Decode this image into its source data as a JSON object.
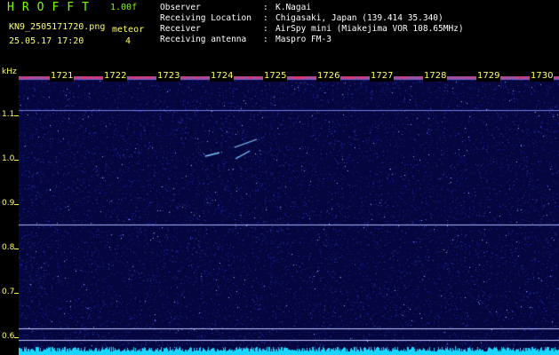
{
  "header": {
    "app_title": "HROFFT",
    "version": "1.00f",
    "filename": "KN9_2505171720.png",
    "mode": "meteor",
    "datetime": "25.05.17 17:20",
    "count": "4"
  },
  "meta": [
    {
      "key": "Observer",
      "value": "K.Nagai"
    },
    {
      "key": "Receiving Location",
      "value": "Chigasaki, Japan (139.414 35.340)"
    },
    {
      "key": "Receiver",
      "value": "AirSpy mini (Miakejima VOR 108.65MHz)"
    },
    {
      "key": "Receiving antenna",
      "value": "Maspro FM-3"
    }
  ],
  "y_axis": {
    "unit": "kHz",
    "ticks": [
      "1.1",
      "1.0",
      "0.9",
      "0.8",
      "0.7",
      "0.6"
    ]
  },
  "x_axis": {
    "minutes": [
      "1721",
      "1722",
      "1723",
      "1724",
      "1725",
      "1726",
      "1727",
      "1728",
      "1729",
      "1730"
    ]
  },
  "colors": {
    "background": "#05063f",
    "label": "#ffff66",
    "title": "#7CFC00"
  }
}
